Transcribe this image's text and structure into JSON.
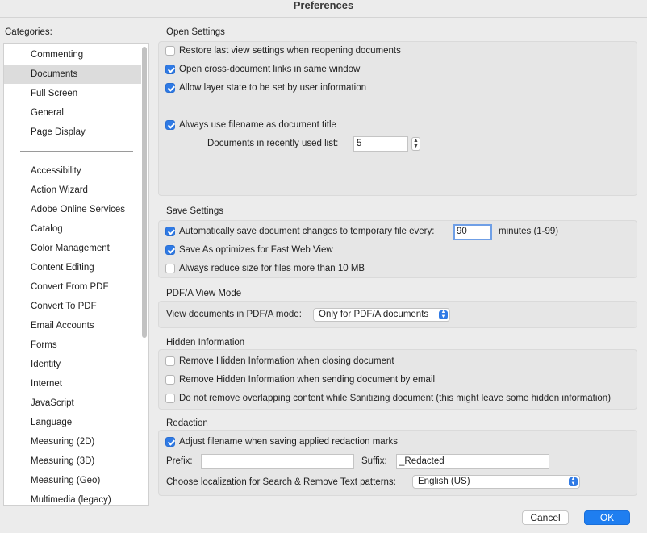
{
  "window": {
    "title": "Preferences"
  },
  "categories": {
    "label": "Categories:",
    "top_items": [
      "Commenting",
      "Documents",
      "Full Screen",
      "General",
      "Page Display"
    ],
    "selected": "Documents",
    "items": [
      "Accessibility",
      "Action Wizard",
      "Adobe Online Services",
      "Catalog",
      "Color Management",
      "Content Editing",
      "Convert From PDF",
      "Convert To PDF",
      "Email Accounts",
      "Forms",
      "Identity",
      "Internet",
      "JavaScript",
      "Language",
      "Measuring (2D)",
      "Measuring (3D)",
      "Measuring (Geo)",
      "Multimedia (legacy)"
    ]
  },
  "open_settings": {
    "title": "Open Settings",
    "restore_last_view": {
      "label": "Restore last view settings when reopening documents",
      "checked": false
    },
    "open_cross_doc_links": {
      "label": "Open cross-document links in same window",
      "checked": true
    },
    "allow_layer_state": {
      "label": "Allow layer state to be set by user information",
      "checked": true
    },
    "filename_as_title": {
      "label": "Always use filename as document title",
      "checked": true
    },
    "recent_list_label": "Documents in recently used list:",
    "recent_list_value": "5"
  },
  "save_settings": {
    "title": "Save Settings",
    "auto_save": {
      "label": "Automatically save document changes to temporary file every:",
      "checked": true
    },
    "auto_save_minutes": "90",
    "minutes_range": "minutes (1-99)",
    "fast_web_view": {
      "label": "Save As optimizes for Fast Web View",
      "checked": true
    },
    "reduce_size": {
      "label": "Always reduce size for files more than 10 MB",
      "checked": false
    }
  },
  "pdfa": {
    "title": "PDF/A View Mode",
    "label": "View documents in PDF/A mode:",
    "value": "Only for PDF/A documents"
  },
  "hidden_info": {
    "title": "Hidden Information",
    "remove_closing": {
      "label": "Remove Hidden Information when closing document",
      "checked": false
    },
    "remove_email": {
      "label": "Remove Hidden Information when sending document by email",
      "checked": false
    },
    "no_remove_overlap": {
      "label": "Do not remove overlapping content while Sanitizing document (this might leave some hidden information)",
      "checked": false
    }
  },
  "redaction": {
    "title": "Redaction",
    "adjust_filename": {
      "label": "Adjust filename when saving applied redaction marks",
      "checked": true
    },
    "prefix_label": "Prefix:",
    "prefix_value": "",
    "suffix_label": "Suffix:",
    "suffix_value": "_Redacted",
    "localization_label": "Choose localization for Search & Remove Text patterns:",
    "localization_value": "English (US)"
  },
  "buttons": {
    "cancel": "Cancel",
    "ok": "OK"
  },
  "colors": {
    "accent": "#2f7ae5",
    "ok_button": "#1f7ef0",
    "selected_row": "#dcdcdc"
  }
}
